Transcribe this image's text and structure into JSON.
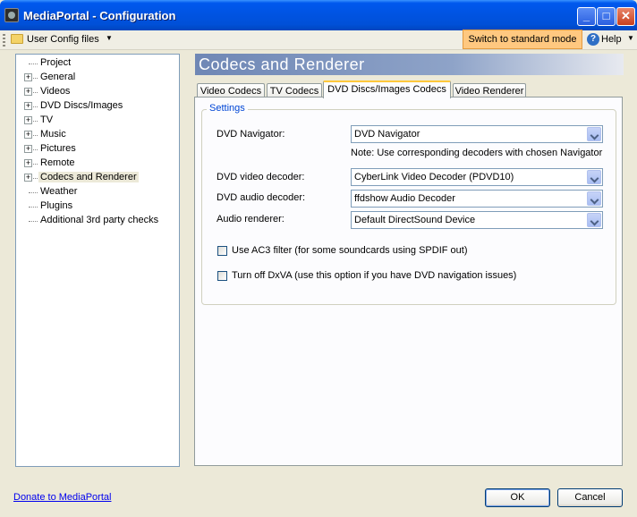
{
  "window": {
    "title": "MediaPortal - Configuration",
    "minimize": "_",
    "maximize": "□",
    "close": "✕"
  },
  "toolbar": {
    "user_config": "User Config files",
    "dropdown_arrow": "▼",
    "switch_mode": "Switch to standard mode",
    "help_icon": "?",
    "help": "Help"
  },
  "tree": {
    "items": [
      {
        "label": "Project",
        "expandable": false
      },
      {
        "label": "General",
        "expandable": true
      },
      {
        "label": "Videos",
        "expandable": true
      },
      {
        "label": "DVD Discs/Images",
        "expandable": true
      },
      {
        "label": "TV",
        "expandable": true
      },
      {
        "label": "Music",
        "expandable": true
      },
      {
        "label": "Pictures",
        "expandable": true
      },
      {
        "label": "Remote",
        "expandable": true
      },
      {
        "label": "Codecs and Renderer",
        "expandable": true,
        "selected": true
      },
      {
        "label": "Weather",
        "expandable": false
      },
      {
        "label": "Plugins",
        "expandable": false
      },
      {
        "label": "Additional 3rd party checks",
        "expandable": false
      }
    ],
    "expand_glyph": "+"
  },
  "main": {
    "heading": "Codecs and Renderer",
    "tabs": [
      {
        "label": "Video Codecs"
      },
      {
        "label": "TV Codecs"
      },
      {
        "label": "DVD Discs/Images Codecs",
        "active": true
      },
      {
        "label": "Video Renderer"
      }
    ],
    "group_title": "Settings",
    "fields": {
      "navigator_label": "DVD Navigator:",
      "navigator_value": "DVD Navigator",
      "note": "Note: Use corresponding decoders with chosen Navigator",
      "video_decoder_label": "DVD video decoder:",
      "video_decoder_value": "CyberLink Video Decoder (PDVD10)",
      "audio_decoder_label": "DVD audio decoder:",
      "audio_decoder_value": "ffdshow Audio Decoder",
      "audio_renderer_label": "Audio renderer:",
      "audio_renderer_value": "Default DirectSound Device"
    },
    "checkboxes": {
      "ac3": "Use AC3 filter (for some soundcards using SPDIF out)",
      "dxva": "Turn off DxVA (use this option if you have DVD navigation issues)"
    }
  },
  "footer": {
    "donate": "Donate to MediaPortal",
    "ok": "OK",
    "cancel": "Cancel"
  }
}
